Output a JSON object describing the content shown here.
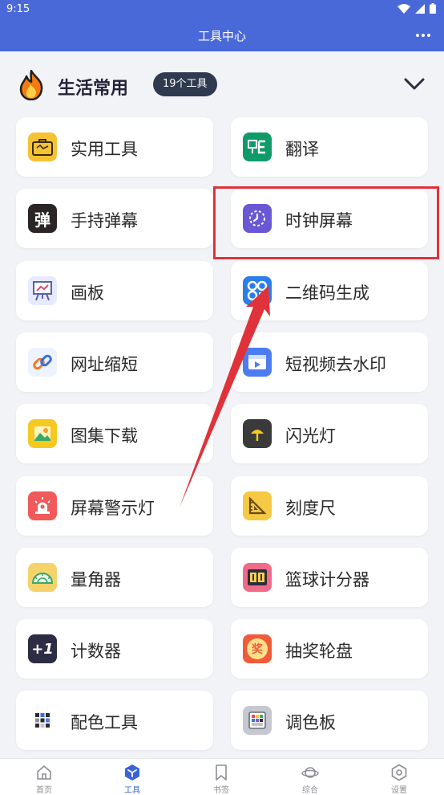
{
  "status_bar": {
    "time": "9:15"
  },
  "header": {
    "title": "工具中心",
    "more_icon": "more-horizontal-icon"
  },
  "section": {
    "title": "生活常用",
    "count_badge": "19个工具",
    "icon": "fire-icon",
    "collapse_icon": "chevron-down-icon"
  },
  "tools": [
    {
      "name": "tool-practical",
      "label": "实用工具",
      "icon": "toolbox-icon",
      "color": "#f5c233"
    },
    {
      "name": "tool-translate",
      "label": "翻译",
      "icon": "translate-icon",
      "color": "#0f9a6a"
    },
    {
      "name": "tool-handheld-barrage",
      "label": "手持弹幕",
      "icon": "barrage-icon",
      "color": "#2b2525",
      "glyph": "弹"
    },
    {
      "name": "tool-clock-screen",
      "label": "时钟屏幕",
      "icon": "clock-icon",
      "color": "#6a57d6"
    },
    {
      "name": "tool-drawing-board",
      "label": "画板",
      "icon": "easel-icon",
      "color": "#e7ebff"
    },
    {
      "name": "tool-qrcode",
      "label": "二维码生成",
      "icon": "qrcode-icon",
      "color": "#2b7de9"
    },
    {
      "name": "tool-url-shortener",
      "label": "网址缩短",
      "icon": "link-icon",
      "color": "#eef4ff"
    },
    {
      "name": "tool-video-watermark",
      "label": "短视频去水印",
      "icon": "video-icon",
      "color": "#4d7cf0"
    },
    {
      "name": "tool-album-download",
      "label": "图集下载",
      "icon": "image-icon",
      "color": "#f6c920"
    },
    {
      "name": "tool-flashlight",
      "label": "闪光灯",
      "icon": "flashlight-icon",
      "color": "#3a3a3a"
    },
    {
      "name": "tool-screen-warning",
      "label": "屏幕警示灯",
      "icon": "warning-light-icon",
      "color": "#f05a5a"
    },
    {
      "name": "tool-ruler",
      "label": "刻度尺",
      "icon": "ruler-icon",
      "color": "#f6c944"
    },
    {
      "name": "tool-protractor",
      "label": "量角器",
      "icon": "protractor-icon",
      "color": "#f6d36a"
    },
    {
      "name": "tool-basketball-scorer",
      "label": "篮球计分器",
      "icon": "scoreboard-icon",
      "color": "#f06b8a"
    },
    {
      "name": "tool-counter",
      "label": "计数器",
      "icon": "counter-icon",
      "color": "#2c2c44",
      "glyph": "+1"
    },
    {
      "name": "tool-lottery-wheel",
      "label": "抽奖轮盘",
      "icon": "lottery-wheel-icon",
      "color": "#f05b3a",
      "glyph": "奖"
    },
    {
      "name": "tool-color-scheme",
      "label": "配色工具",
      "icon": "palette-grid-icon",
      "color": "#ffffff"
    },
    {
      "name": "tool-color-palette",
      "label": "调色板",
      "icon": "color-palette-icon",
      "color": "#c5c8d0"
    }
  ],
  "nav": [
    {
      "name": "nav-home",
      "label": "首页",
      "icon": "home-icon",
      "active": false
    },
    {
      "name": "nav-tools",
      "label": "工具",
      "icon": "tools-cube-icon",
      "active": true
    },
    {
      "name": "nav-bookmarks",
      "label": "书签",
      "icon": "bookmark-icon",
      "active": false
    },
    {
      "name": "nav-discover",
      "label": "综合",
      "icon": "planet-icon",
      "active": false
    },
    {
      "name": "nav-settings",
      "label": "设置",
      "icon": "settings-icon",
      "active": false
    }
  ],
  "colors": {
    "primary": "#4a69d9",
    "highlight": "#e0323a",
    "badge_bg": "#2f3a4f"
  }
}
